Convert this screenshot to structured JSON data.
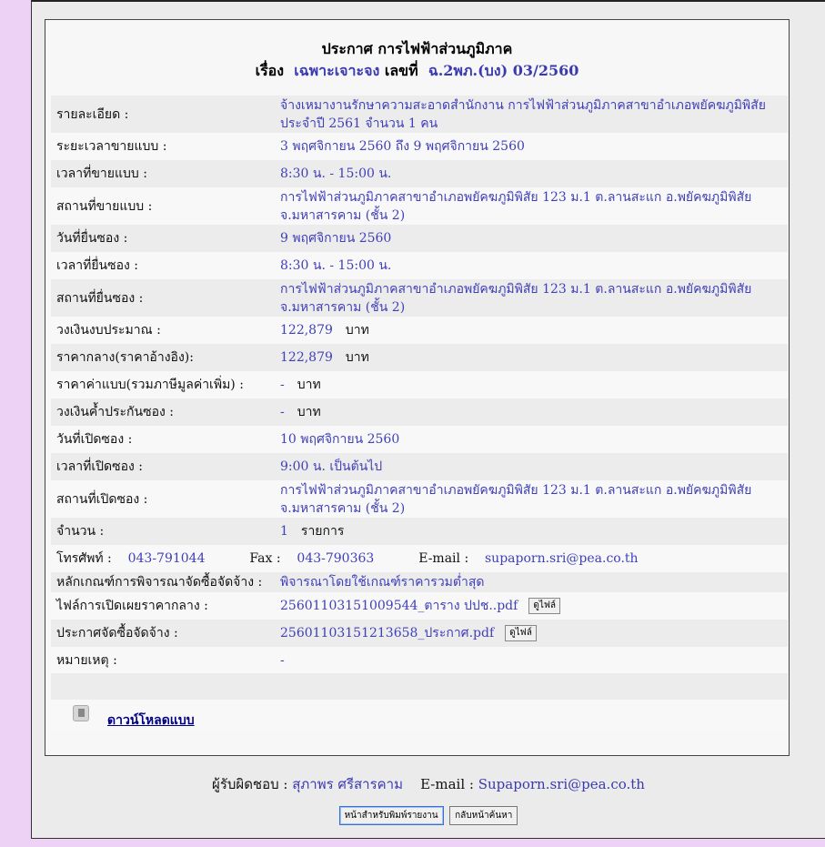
{
  "header": {
    "title": "ประกาศ การไฟฟ้าส่วนภูมิภาค",
    "subject_label": "เรื่อง",
    "subject_value": "เฉพาะเจาะจง",
    "number_label": "เลขที่",
    "number_value": "ฉ.2พภ.(บง) 03/2560"
  },
  "rows": [
    {
      "label": "รายละเอียด :",
      "value": "จ้างเหมางานรักษาความสะอาดสำนักงาน การไฟฟ้าส่วนภูมิภาคสาขาอำเภอพยัคฆภูมิพิสัย ประจำปี 2561 จำนวน 1 คน"
    },
    {
      "label": "ระยะเวลาขายแบบ :",
      "value": "3 พฤศจิกายน 2560 ถึง 9 พฤศจิกายน 2560"
    },
    {
      "label": "เวลาที่ขายแบบ :",
      "value": "8:30 น. - 15:00 น."
    },
    {
      "label": "สถานที่ขายแบบ :",
      "value": "การไฟฟ้าส่วนภูมิภาคสาขาอำเภอพยัคฆภูมิพิสัย 123 ม.1 ต.ลานสะแก อ.พยัคฆภูมิพิสัย จ.มหาสารคาม (ชั้น 2)"
    },
    {
      "label": "วันที่ยื่นซอง :",
      "value": "9 พฤศจิกายน 2560"
    },
    {
      "label": "เวลาที่ยื่นซอง :",
      "value": "8:30 น. - 15:00 น."
    },
    {
      "label": "สถานที่ยื่นซอง :",
      "value": "การไฟฟ้าส่วนภูมิภาคสาขาอำเภอพยัคฆภูมิพิสัย 123 ม.1 ต.ลานสะแก อ.พยัคฆภูมิพิสัย จ.มหาสารคาม (ชั้น 2)"
    },
    {
      "label": "วงเงินงบประมาณ :",
      "value": "122,879",
      "unit": "บาท"
    },
    {
      "label": "ราคากลาง(ราคาอ้างอิง):",
      "value": "122,879",
      "unit": "บาท"
    },
    {
      "label": "ราคาค่าแบบ(รวมภาษีมูลค่าเพิ่ม) :",
      "value": "-",
      "unit": "บาท"
    },
    {
      "label": "วงเงินค้ำประกันซอง :",
      "value": "-",
      "unit": "บาท"
    },
    {
      "label": "วันที่เปิดซอง :",
      "value": "10 พฤศจิกายน 2560"
    },
    {
      "label": "เวลาที่เปิดซอง :",
      "value": "9:00 น. เป็นต้นไป"
    },
    {
      "label": "สถานที่เปิดซอง :",
      "value": "การไฟฟ้าส่วนภูมิภาคสาขาอำเภอพยัคฆภูมิพิสัย 123 ม.1 ต.ลานสะแก อ.พยัคฆภูมิพิสัย จ.มหาสารคาม (ชั้น 2)"
    },
    {
      "label": "จำนวน :",
      "value": "1",
      "unit": "รายการ"
    }
  ],
  "contact": {
    "phone_label": "โทรศัพท์ :",
    "phone": "043-791044",
    "fax_label": "Fax :",
    "fax": "043-790363",
    "email_label": "E-mail :",
    "email": "supaporn.sri@pea.co.th"
  },
  "criteria": {
    "label": "หลักเกณฑ์การพิจารณาจัดซื้อจัดจ้าง :",
    "value": "พิจารณาโดยใช้เกณฑ์ราคารวมต่ำสุด"
  },
  "files": [
    {
      "label": "ไฟล์การเปิดเผยราคากลาง :",
      "file": "25601103151009544_ตาราง ปปช..pdf",
      "button": "ดูไฟล์"
    },
    {
      "label": "ประกาศจัดซื้อจัดจ้าง :",
      "file": "25601103151213658_ประกาศ.pdf",
      "button": "ดูไฟล์"
    }
  ],
  "remark": {
    "label": "หมายเหตุ :",
    "value": "-"
  },
  "download": {
    "label": "ดาวน์โหลดแบบ"
  },
  "footer": {
    "responsible_label": "ผู้รับผิดชอบ :",
    "responsible_name": "สุภาพร ศรีสารคาม",
    "email_label": "E-mail :",
    "email": "Supaporn.sri@pea.co.th"
  },
  "buttons": {
    "print": "หน้าสำหรับพิมพ์รายงาน",
    "back": "กลับหน้าค้นหา"
  },
  "colors": {
    "page_bg": "#eed2f5",
    "link_blue": "#4040b8",
    "panel_bg": "#f7f7f7"
  }
}
